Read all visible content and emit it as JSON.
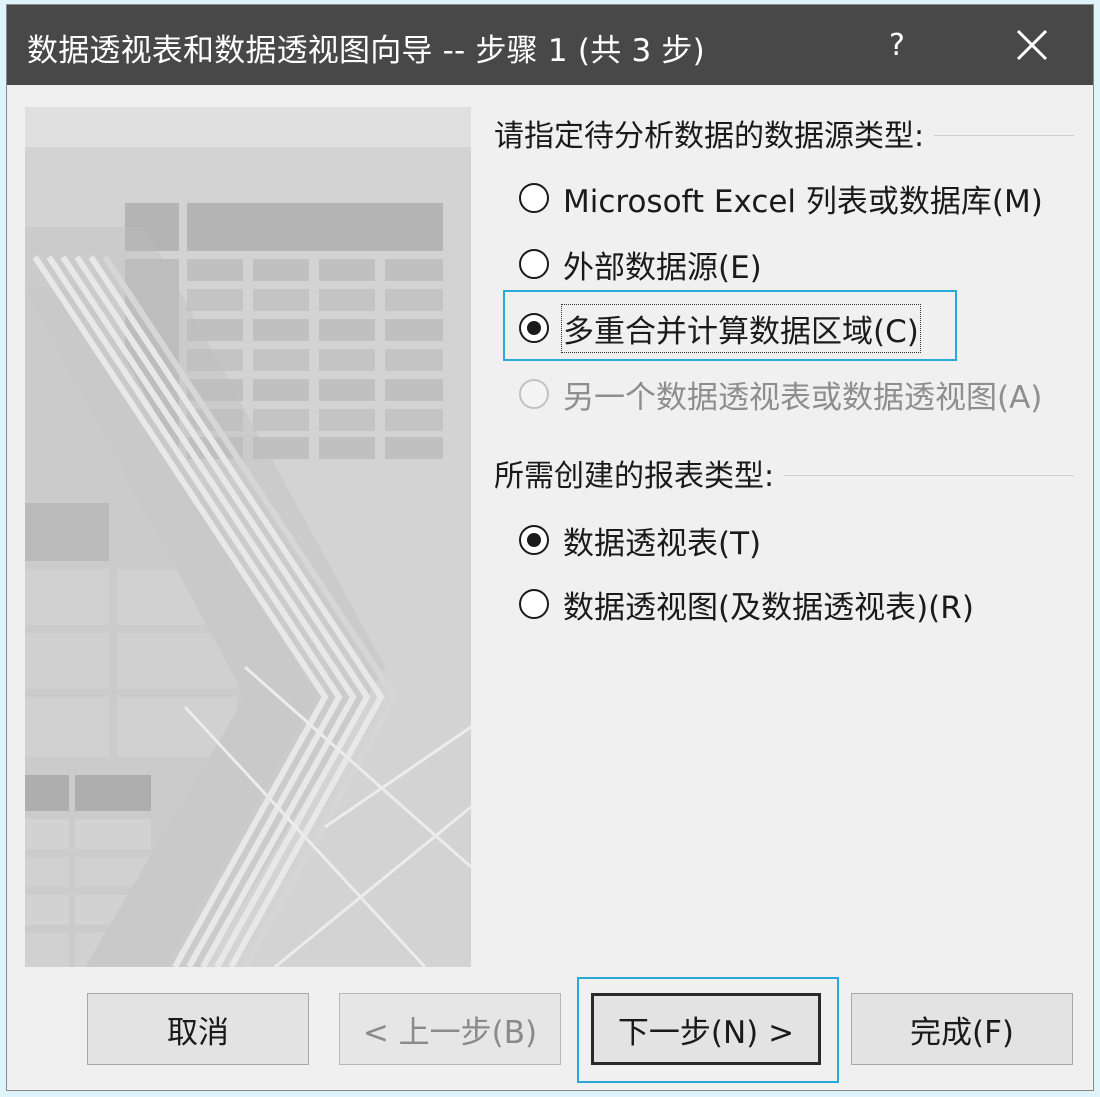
{
  "window": {
    "title": "数据透视表和数据透视图向导 -- 步骤 1 (共 3 步)",
    "help_label": "?"
  },
  "source_group": {
    "title": "请指定待分析数据的数据源类型:",
    "options": [
      {
        "label": "Microsoft Excel 列表或数据库(M)",
        "checked": false,
        "enabled": true
      },
      {
        "label": "外部数据源(E)",
        "checked": false,
        "enabled": true
      },
      {
        "label": "多重合并计算数据区域(C)",
        "checked": true,
        "enabled": true
      },
      {
        "label": "另一个数据透视表或数据透视图(A)",
        "checked": false,
        "enabled": false
      }
    ]
  },
  "report_group": {
    "title": "所需创建的报表类型:",
    "options": [
      {
        "label": "数据透视表(T)",
        "checked": true,
        "enabled": true
      },
      {
        "label": "数据透视图(及数据透视表)(R)",
        "checked": false,
        "enabled": true
      }
    ]
  },
  "buttons": {
    "cancel": "取消",
    "back": "< 上一步(B)",
    "next": "下一步(N) >",
    "finish": "完成(F)"
  },
  "colors": {
    "titlebar": "#484848",
    "dialog_bg": "#f0f0f0",
    "highlight": "#28a9d9",
    "page_bg": "#dff3fa"
  },
  "icons": {
    "close": "close-icon",
    "illustration": "wizard-illustration"
  }
}
